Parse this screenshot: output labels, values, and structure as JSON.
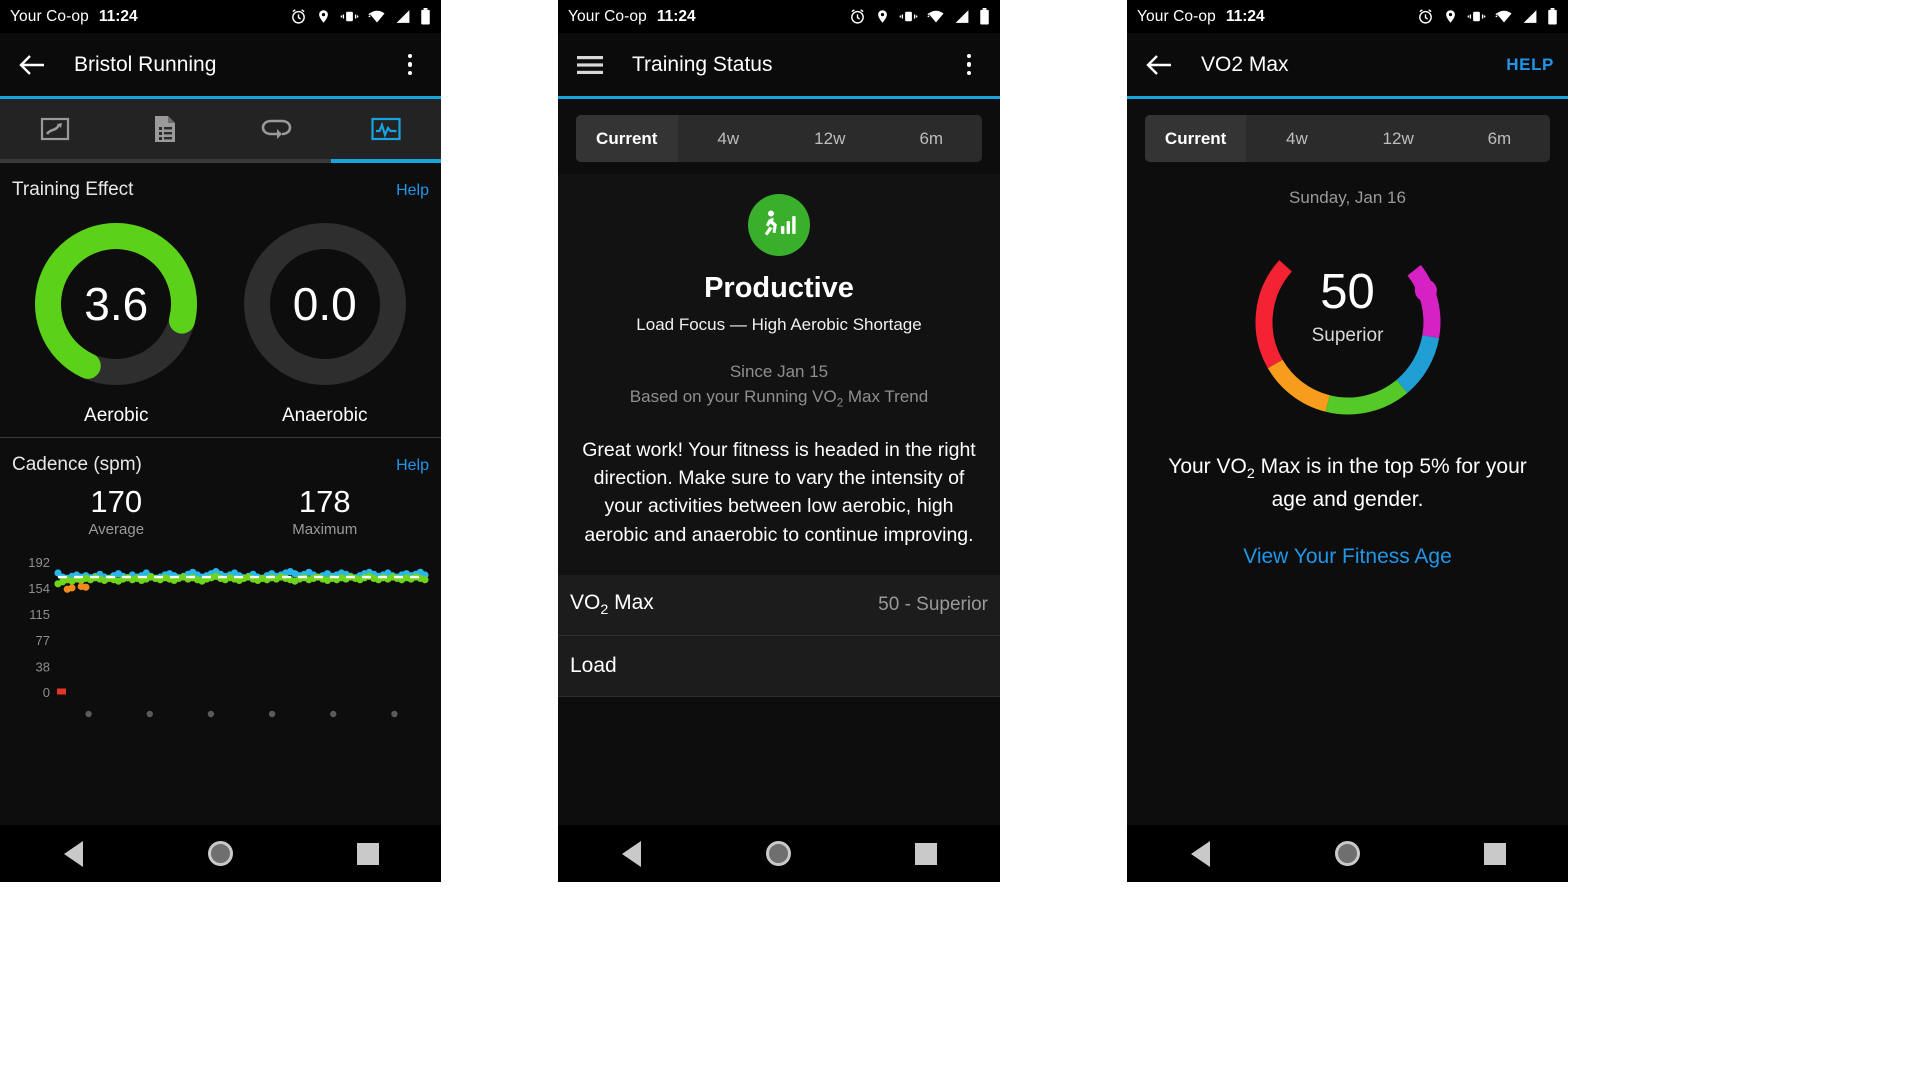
{
  "status_bar": {
    "carrier": "Your Co-op",
    "time": "11:24",
    "icons": [
      "alarm-icon",
      "location-icon",
      "vibrate-icon",
      "wifi-icon",
      "signal-icon",
      "battery-icon"
    ]
  },
  "colors": {
    "accent": "#17a3e0",
    "link": "#2196e8",
    "aerobic_green": "#5cd11a",
    "badge_green": "#39af2c",
    "track": "#2e2e2e",
    "gauge_red": "#f42334",
    "gauge_orange": "#f79c1d",
    "gauge_green": "#54c928",
    "gauge_blue": "#1f9fd4",
    "gauge_magenta": "#d621c4",
    "cadence_blue": "#29b6e8",
    "cadence_green": "#6fd41c",
    "cadence_orange": "#f08a1e",
    "cadence_red": "#e8352a"
  },
  "panel1": {
    "appbar": {
      "back_label": "back-arrow",
      "title": "Bristol Running",
      "menu_label": "overflow-menu"
    },
    "tabs": [
      {
        "id": "map",
        "icon": "map-icon",
        "active": false
      },
      {
        "id": "details",
        "icon": "document-list-icon",
        "active": false
      },
      {
        "id": "laps",
        "icon": "loop-arrow-icon",
        "active": false
      },
      {
        "id": "charts",
        "icon": "activity-graph-icon",
        "active": true
      }
    ],
    "training_effect": {
      "title": "Training Effect",
      "help": "Help",
      "gauges": [
        {
          "label": "Aerobic",
          "value": "3.6",
          "fraction": 0.72,
          "color": "#5cd11a"
        },
        {
          "label": "Anaerobic",
          "value": "0.0",
          "fraction": 0.0,
          "color": "#5cd11a"
        }
      ]
    },
    "cadence": {
      "title": "Cadence (spm)",
      "help": "Help",
      "stats": [
        {
          "value": "170",
          "caption": "Average"
        },
        {
          "value": "178",
          "caption": "Maximum"
        }
      ]
    }
  },
  "panel2": {
    "appbar": {
      "menu_label": "hamburger-menu",
      "title": "Training Status",
      "overflow_label": "overflow-menu"
    },
    "segments": [
      {
        "label": "Current",
        "active": true
      },
      {
        "label": "4w",
        "active": false
      },
      {
        "label": "12w",
        "active": false
      },
      {
        "label": "6m",
        "active": false
      }
    ],
    "body": {
      "badge_icon": "running-bars-icon",
      "status": "Productive",
      "subtitle": "Load Focus — High Aerobic Shortage",
      "since": "Since Jan 15",
      "based_on_prefix": "Based on your Running VO",
      "based_on_sub": "2",
      "based_on_suffix": " Max Trend",
      "paragraph": "Great work! Your fitness is headed in the right direction. Make sure to vary the intensity of your activities between low aerobic, high aerobic and anaerobic to continue improving."
    },
    "rows": [
      {
        "label_prefix": "VO",
        "label_sub": "2",
        "label_suffix": " Max",
        "value": "50 - Superior"
      },
      {
        "label_prefix": "Load",
        "label_sub": "",
        "label_suffix": "",
        "value": ""
      }
    ]
  },
  "panel3": {
    "appbar": {
      "back_label": "back-arrow",
      "title": "VO2 Max",
      "help": "HELP"
    },
    "segments": [
      {
        "label": "Current",
        "active": true
      },
      {
        "label": "4w",
        "active": false
      },
      {
        "label": "12w",
        "active": false
      },
      {
        "label": "6m",
        "active": false
      }
    ],
    "date": "Sunday, Jan 16",
    "gauge": {
      "value": "50",
      "category": "Superior",
      "marker_color": "#d621c4",
      "arcs": [
        {
          "name": "red",
          "color": "#f42334",
          "start_deg": 138,
          "sweep_deg": 72
        },
        {
          "name": "orange",
          "color": "#f79c1d",
          "start_deg": 210,
          "sweep_deg": 46
        },
        {
          "name": "green",
          "color": "#54c928",
          "start_deg": 256,
          "sweep_deg": 54
        },
        {
          "name": "blue",
          "color": "#1f9fd4",
          "start_deg": 310,
          "sweep_deg": 40
        },
        {
          "name": "magenta",
          "color": "#d621c4",
          "start_deg": 350,
          "sweep_deg": 48
        }
      ],
      "marker_deg": 22
    },
    "description_prefix": "Your VO",
    "description_sub": "2",
    "description_suffix": " Max is in the top 5% for your age and gender.",
    "link": "View Your Fitness Age"
  },
  "navbar": {
    "back": "back-triangle-icon",
    "home": "home-circle-icon",
    "recents": "recents-square-icon"
  },
  "chart_data": {
    "type": "scatter",
    "title": "Cadence (spm)",
    "xlabel": "",
    "ylabel": "spm",
    "ylim": [
      0,
      210
    ],
    "yticks": [
      0,
      38,
      77,
      115,
      154,
      192
    ],
    "ytick_labels": [
      "0",
      "38",
      "77",
      "115",
      "154",
      "192"
    ],
    "grid": false,
    "legend": "none",
    "average_line": 170,
    "series": [
      {
        "name": "cadence-blue",
        "color": "#29b6e8",
        "values": [
          176,
          170,
          168,
          171,
          173,
          170,
          172,
          169,
          171,
          174,
          170,
          168,
          172,
          175,
          171,
          169,
          173,
          170,
          172,
          176,
          171,
          168,
          170,
          173,
          175,
          172,
          169,
          171,
          174,
          177,
          173,
          170,
          172,
          175,
          178,
          174,
          171,
          173,
          176,
          172,
          169,
          171,
          174,
          170,
          168,
          172,
          175,
          171,
          173,
          176,
          178,
          175,
          172,
          174,
          177,
          173,
          170,
          172,
          175,
          171,
          173,
          176,
          174,
          171,
          169,
          172,
          175,
          177,
          174,
          171,
          173,
          176,
          172,
          170,
          173,
          175,
          172,
          174,
          177,
          173
        ]
      },
      {
        "name": "cadence-green",
        "color": "#6fd41c",
        "values": [
          160,
          163,
          166,
          164,
          167,
          165,
          168,
          166,
          169,
          167,
          165,
          168,
          166,
          164,
          167,
          169,
          166,
          168,
          165,
          167,
          170,
          168,
          166,
          169,
          167,
          165,
          168,
          170,
          167,
          169,
          166,
          164,
          167,
          169,
          171,
          168,
          166,
          169,
          167,
          165,
          168,
          170,
          167,
          165,
          168,
          166,
          169,
          167,
          170,
          168,
          166,
          164,
          167,
          169,
          166,
          168,
          170,
          167,
          165,
          168,
          166,
          169,
          167,
          170,
          168,
          166,
          169,
          171,
          168,
          166,
          169,
          167,
          170,
          168,
          166,
          169,
          167,
          170,
          168,
          166
        ]
      },
      {
        "name": "cadence-orange",
        "color": "#f08a1e",
        "values": [
          null,
          null,
          152,
          154,
          null,
          156,
          155,
          null,
          null,
          null,
          null,
          null,
          null,
          null,
          null,
          null,
          null,
          null,
          null,
          null,
          null,
          null,
          null,
          null,
          null,
          null,
          null,
          null,
          null,
          null,
          null,
          null,
          null,
          null,
          null,
          null,
          null,
          null,
          null,
          null,
          null,
          null,
          null,
          null,
          null,
          null,
          null,
          null,
          null,
          null,
          null,
          null,
          null,
          null,
          null,
          null,
          null,
          null,
          null,
          null,
          null,
          null,
          null,
          null,
          null,
          null,
          null,
          null,
          null,
          null,
          null,
          null,
          null,
          null,
          null,
          null,
          null,
          null,
          null,
          null
        ]
      }
    ],
    "x_axis_dots": 6,
    "zero_marker": {
      "color": "#e8352a",
      "value": 0
    }
  }
}
